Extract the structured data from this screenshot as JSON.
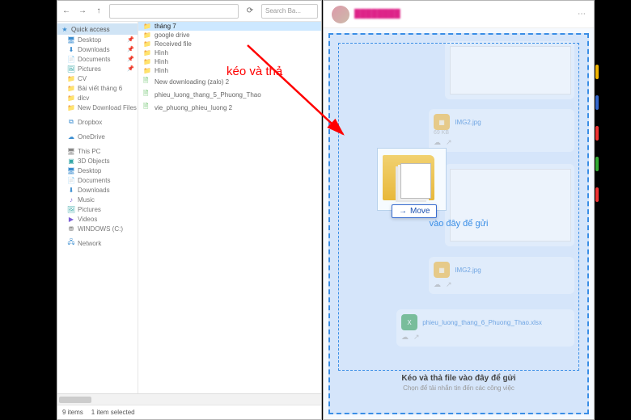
{
  "explorer": {
    "address_placeholder": "",
    "search_placeholder": "Search Ba...",
    "sidebar": {
      "quick_access": {
        "label": "Quick access",
        "icon": "★"
      },
      "quick_items": [
        {
          "label": "Desktop",
          "icon": "🖥",
          "cls": "c-blue",
          "pinned": true
        },
        {
          "label": "Downloads",
          "icon": "⬇",
          "cls": "c-blue",
          "pinned": true
        },
        {
          "label": "Documents",
          "icon": "📄",
          "cls": "c-teal",
          "pinned": true
        },
        {
          "label": "Pictures",
          "icon": "🖼",
          "cls": "c-teal",
          "pinned": true
        },
        {
          "label": "CV",
          "icon": "📁",
          "cls": "c-yel",
          "pinned": false
        },
        {
          "label": "Bài viết tháng 6",
          "icon": "📁",
          "cls": "c-yel",
          "pinned": false
        },
        {
          "label": "dlcv",
          "icon": "📁",
          "cls": "c-yel",
          "pinned": false
        },
        {
          "label": "New Download Files",
          "icon": "📁",
          "cls": "c-yel",
          "pinned": false
        }
      ],
      "dropbox": {
        "label": "Dropbox",
        "icon": "⧉",
        "cls": "c-blue"
      },
      "onedrive": {
        "label": "OneDrive",
        "icon": "☁",
        "cls": "c-blue"
      },
      "thispc": {
        "label": "This PC",
        "icon": "🖥",
        "cls": "c-gray"
      },
      "pc_items": [
        {
          "label": "3D Objects",
          "icon": "▣",
          "cls": "c-teal"
        },
        {
          "label": "Desktop",
          "icon": "🖥",
          "cls": "c-blue"
        },
        {
          "label": "Documents",
          "icon": "📄",
          "cls": "c-teal"
        },
        {
          "label": "Downloads",
          "icon": "⬇",
          "cls": "c-blue"
        },
        {
          "label": "Music",
          "icon": "♪",
          "cls": "c-purple"
        },
        {
          "label": "Pictures",
          "icon": "🖼",
          "cls": "c-teal"
        },
        {
          "label": "Videos",
          "icon": "▶",
          "cls": "c-purple"
        },
        {
          "label": "WINDOWS (C:)",
          "icon": "⛃",
          "cls": "c-gray"
        }
      ],
      "network": {
        "label": "Network",
        "icon": "🖧",
        "cls": "c-blue"
      }
    },
    "files": [
      {
        "name": "tháng 7",
        "icon": "📁",
        "cls": "c-yel",
        "selected": true
      },
      {
        "name": "google drive",
        "icon": "📁",
        "cls": "c-yel"
      },
      {
        "name": "Received file",
        "icon": "📁",
        "cls": "c-yel"
      },
      {
        "name": "Hình",
        "icon": "📁",
        "cls": "c-yel"
      },
      {
        "name": "Hình",
        "icon": "📁",
        "cls": "c-yel"
      },
      {
        "name": "Hình",
        "icon": "📁",
        "cls": "c-yel"
      },
      {
        "name": "New downloading (zalo) 2",
        "icon": "🗎",
        "cls": "c-green"
      },
      {
        "name": "phieu_luong_thang_5_Phuong_Thao",
        "icon": "🗎",
        "cls": "c-green"
      },
      {
        "name": "vie_phuong_phieu_luong 2",
        "icon": "🗎",
        "cls": "c-green"
      }
    ],
    "status": {
      "items": "9 items",
      "selected": "1 item selected"
    }
  },
  "zalo": {
    "drop_center": "vào đây để gửi",
    "footer_title": "Kéo và thả file vào đây để gửi",
    "footer_sub": "Chọn để tải nhắn tin đến các công việc",
    "messages": {
      "m1_file": "IMG2.jpg",
      "m1_size": "69 KB",
      "m2_file": "IMG2.jpg",
      "m3_file": "phieu_luong_thang_6_Phuong_Thao.xlsx"
    }
  },
  "annotation": {
    "text": "kéo và thả"
  },
  "drag": {
    "move_label": "Move"
  }
}
